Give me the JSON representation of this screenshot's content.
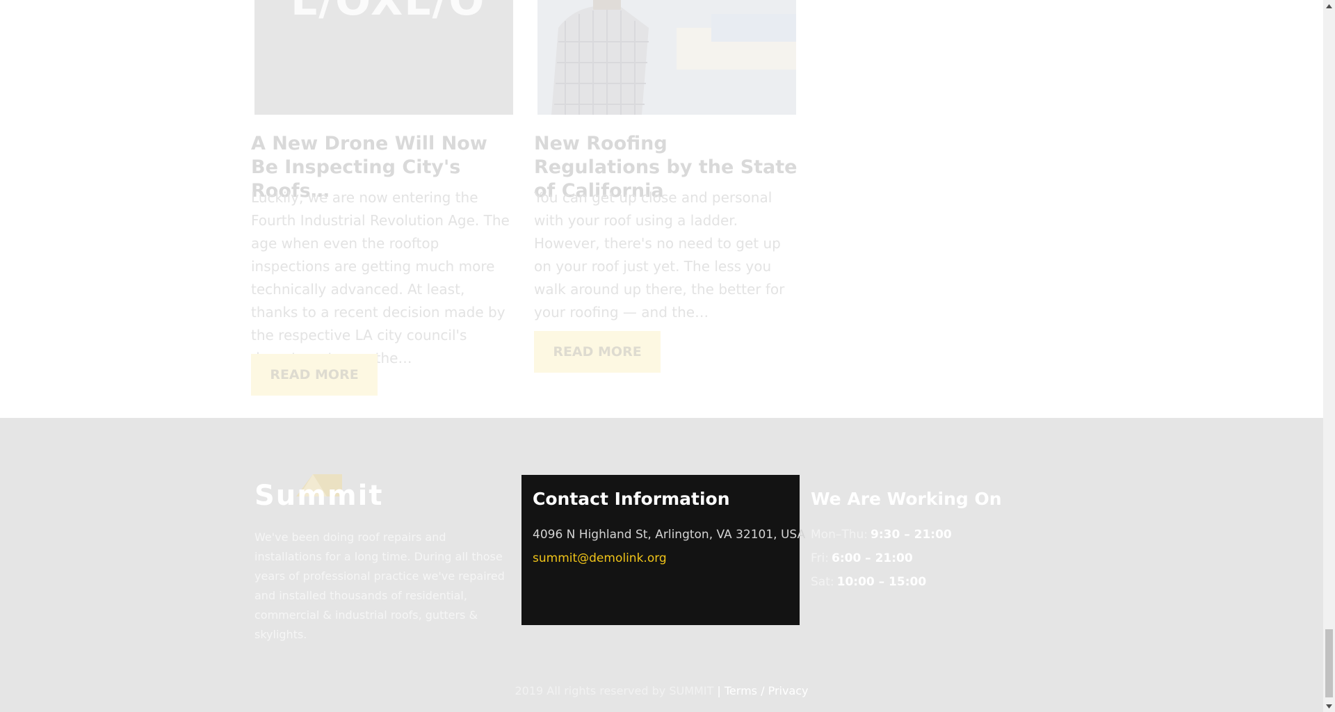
{
  "posts": [
    {
      "thumb_text": "L/OXL/O",
      "title": "A New Drone Will Now Be Inspecting City's Roofs…",
      "excerpt": "Luckily, we are now entering the Fourth Industrial Revolution Age. The age when even the rooftop inspections are getting much more technically advanced. At least, thanks to a recent decision made by the respective LA city council's department, now the…",
      "button": "READ MORE"
    },
    {
      "title": "New Roofing Regulations by the State of California",
      "excerpt": "You can get up close and personal with your roof using a ladder. However, there's no need to get up on your roof just yet. The less you walk around up there, the better for your roofing — and the…",
      "button": "READ MORE"
    }
  ],
  "footer": {
    "logo_text": "Summit",
    "about": "We've been doing roof repairs and installations for a long time. During all those years of professional practice we've repaired and installed thousands of residential, commercial & industrial roofs, gutters & skylights.",
    "contact": {
      "heading": "Contact Information",
      "address": "4096 N Highland St, Arlington, VA 32101, USA",
      "email": "summit@demolink.org"
    },
    "hours": {
      "heading": "We Are Working On",
      "rows": [
        {
          "day": "Mon–Thu:",
          "time": "9:30 – 21:00"
        },
        {
          "day": "Fri:",
          "time": "6:00 – 21:00"
        },
        {
          "day": "Sat:",
          "time": "10:00 – 15:00"
        }
      ]
    },
    "copyright": "2019 All rights reserved by SUMMIT",
    "separator": "|",
    "terms": "Terms",
    "slash": "/",
    "privacy": "Privacy"
  },
  "colors": {
    "accent": "#f0c419",
    "footer_bg": "#e5e5e5",
    "contact_bg": "#131313",
    "button_bg": "#fdf8e2"
  },
  "icons": [
    "scroll-up-arrow-icon",
    "scroll-down-arrow-icon",
    "roof-logo-icon"
  ]
}
